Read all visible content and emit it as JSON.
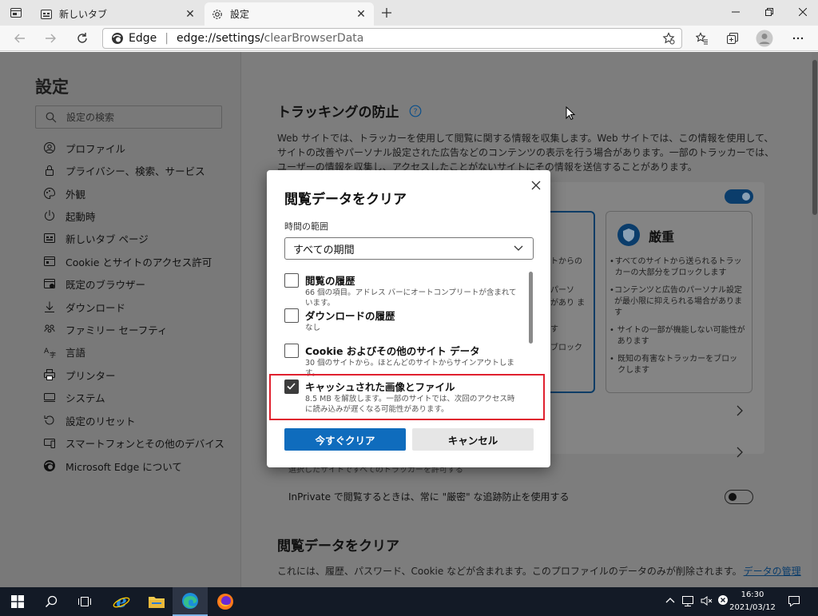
{
  "tabs": [
    {
      "label": "新しいタブ",
      "icon": "new-tab-page-icon"
    },
    {
      "label": "設定",
      "icon": "gear-icon"
    }
  ],
  "omnibox": {
    "brand": "Edge",
    "separator": "|",
    "url_host": "edge://settings/",
    "url_path": "clearBrowserData"
  },
  "sidebar": {
    "title": "設定",
    "search_placeholder": "設定の検索",
    "items": [
      {
        "label": "プロファイル",
        "icon": "profile-icon"
      },
      {
        "label": "プライバシー、検索、サービス",
        "icon": "lock-icon"
      },
      {
        "label": "外観",
        "icon": "appearance-icon"
      },
      {
        "label": "起動時",
        "icon": "power-icon"
      },
      {
        "label": "新しいタブ ページ",
        "icon": "new-tab-page-icon"
      },
      {
        "label": "Cookie とサイトのアクセス許可",
        "icon": "site-permissions-icon"
      },
      {
        "label": "既定のブラウザー",
        "icon": "default-browser-icon"
      },
      {
        "label": "ダウンロード",
        "icon": "download-icon"
      },
      {
        "label": "ファミリー セーフティ",
        "icon": "family-icon"
      },
      {
        "label": "言語",
        "icon": "language-icon"
      },
      {
        "label": "プリンター",
        "icon": "printer-icon"
      },
      {
        "label": "システム",
        "icon": "system-icon"
      },
      {
        "label": "設定のリセット",
        "icon": "reset-icon"
      },
      {
        "label": "スマートフォンとその他のデバイス",
        "icon": "phone-icon"
      },
      {
        "label": "Microsoft Edge について",
        "icon": "edge-logo-icon"
      }
    ]
  },
  "main": {
    "tracking_title": "トラッキングの防止",
    "tracking_desc": "Web サイトでは、トラッカーを使用して閲覧に関する情報を収集します。Web サイトでは、この情報を使用して、サイトの改善やパーソナル設定された広告などのコンテンツの表示を行う場合があります。一部のトラッカーでは、ユーザーの情報を収集し、アクセスしたことがないサイトにその情報を送信することがあります。",
    "balanced_fragments": [
      "イトからの",
      "パーソ",
      "があり ま",
      "す",
      "をブロック"
    ],
    "strict": {
      "title": "厳重",
      "bullets": [
        "すべてのサイトから送られるトラッカーの大部分をブロックします",
        "コンテンツと広告のパーソナル設定が最小限に抑えられる場合があります",
        "サイトの一部が機能しない可能性があります",
        "既知の有害なトラッカーをブロックします"
      ]
    },
    "exceptions_fragment": "選択したサイトですべてのトラッカーを許可する",
    "inprivate_label": "InPrivate で閲覧するときは、常に \"厳密\" な追跡防止を使用する",
    "clear_title": "閲覧データをクリア",
    "clear_desc": "これには、履歴、パスワード、Cookie などが含まれます。このプロファイルのデータのみが削除されます。",
    "manage_link": "データの管理"
  },
  "dialog": {
    "title": "閲覧データをクリア",
    "range_label": "時間の範囲",
    "range_value": "すべての期間",
    "options": [
      {
        "label": "閲覧の履歴",
        "desc": "66 個の項目。アドレス バーにオートコンプリートが含まれています。",
        "checked": false
      },
      {
        "label": "ダウンロードの履歴",
        "desc": "なし",
        "checked": false
      },
      {
        "label": "Cookie およびその他のサイト データ",
        "desc": "30 個のサイトから。ほとんどのサイトからサインアウトします。",
        "checked": false
      },
      {
        "label": "キャッシュされた画像とファイル",
        "desc": "8.5 MB を解放します。一部のサイトでは、次回のアクセス時に読み込みが遅くなる可能性があります。",
        "checked": true
      }
    ],
    "confirm_label": "今すぐクリア",
    "cancel_label": "キャンセル"
  },
  "taskbar": {
    "time": "16:30",
    "date": "2021/03/12"
  },
  "colors": {
    "accent": "#0f6cbd",
    "highlight": "#e0202e",
    "taskbar": "#131a26"
  }
}
